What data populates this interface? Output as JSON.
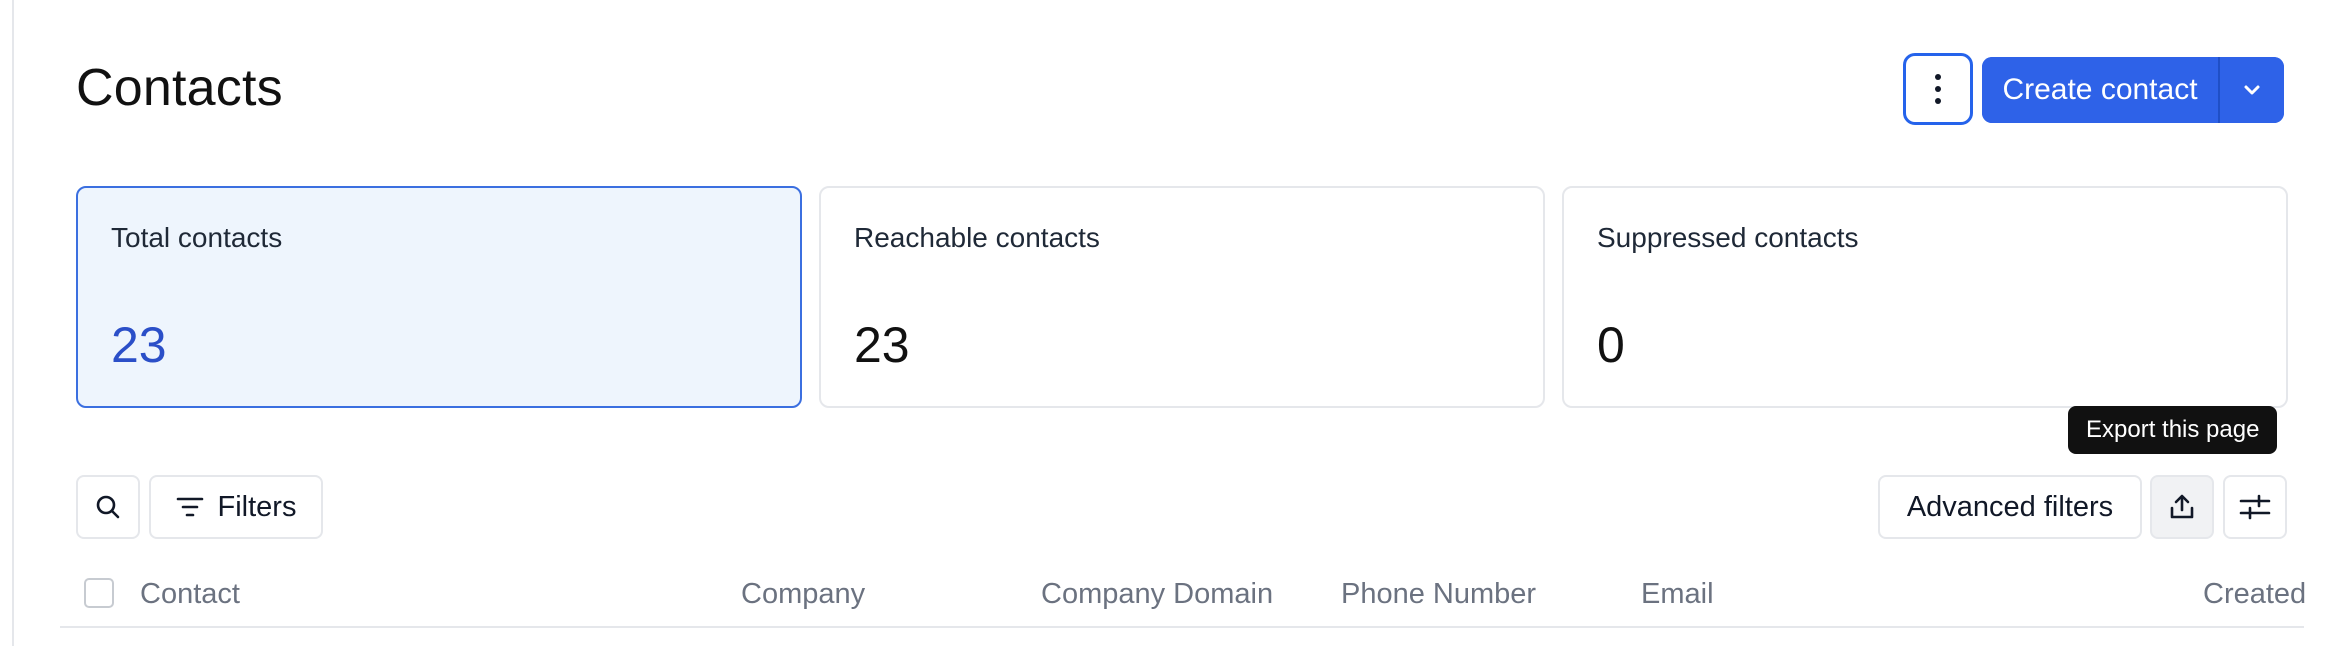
{
  "page": {
    "title": "Contacts"
  },
  "header": {
    "more_icon": "vertical-dots-icon",
    "create_label": "Create contact",
    "create_caret_icon": "chevron-down-icon",
    "accent_color": "#2e62e8"
  },
  "stats": [
    {
      "label": "Total contacts",
      "value": "23",
      "selected": true
    },
    {
      "label": "Reachable contacts",
      "value": "23",
      "selected": false
    },
    {
      "label": "Suppressed contacts",
      "value": "0",
      "selected": false
    }
  ],
  "toolbar": {
    "search_icon": "search-icon",
    "filters_label": "Filters",
    "filters_icon": "filter-lines-icon",
    "advanced_filters_label": "Advanced filters",
    "export_icon": "upload-icon",
    "columns_icon": "sliders-icon",
    "export_tooltip": "Export this page"
  },
  "table": {
    "columns": [
      "Contact",
      "Company",
      "Company Domain",
      "Phone Number",
      "Email",
      "Created"
    ]
  }
}
